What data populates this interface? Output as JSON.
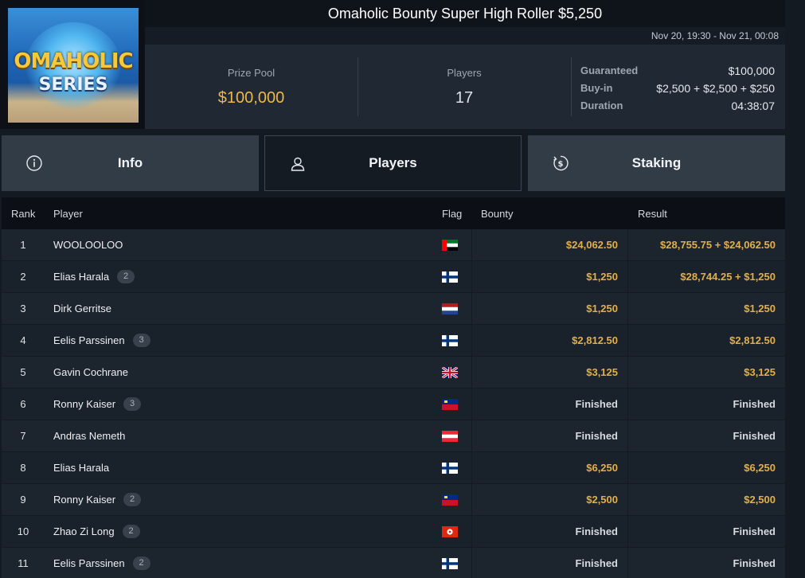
{
  "header": {
    "logo_text_top": "OMAHOLIC",
    "logo_text_bottom": "SERIES",
    "title": "Omaholic Bounty Super High Roller $5,250",
    "dates": "Nov 20, 19:30 - Nov 21, 00:08",
    "prize_pool_label": "Prize Pool",
    "prize_pool_value": "$100,000",
    "players_label": "Players",
    "players_value": "17",
    "details": [
      {
        "key": "Guaranteed",
        "value": "$100,000"
      },
      {
        "key": "Buy-in",
        "value": "$2,500 + $2,500 + $250"
      },
      {
        "key": "Duration",
        "value": "04:38:07"
      }
    ]
  },
  "tabs": [
    {
      "label": "Info",
      "icon": "info-icon",
      "active": false
    },
    {
      "label": "Players",
      "icon": "user-icon",
      "active": true
    },
    {
      "label": "Staking",
      "icon": "dollar-coin-icon",
      "active": false
    }
  ],
  "table": {
    "headers": {
      "rank": "Rank",
      "player": "Player",
      "flag": "Flag",
      "bounty": "Bounty",
      "result": "Result"
    },
    "rows": [
      {
        "rank": "1",
        "player": "WOOLOOLOO",
        "badge": "",
        "flag": "uae",
        "bounty": "$24,062.50",
        "result": "$28,755.75 + $24,062.50"
      },
      {
        "rank": "2",
        "player": "Elias Harala",
        "badge": "2",
        "flag": "finland",
        "bounty": "$1,250",
        "result": "$28,744.25 + $1,250"
      },
      {
        "rank": "3",
        "player": "Dirk Gerritse",
        "badge": "",
        "flag": "netherlands",
        "bounty": "$1,250",
        "result": "$1,250"
      },
      {
        "rank": "4",
        "player": "Eelis Parssinen",
        "badge": "3",
        "flag": "finland",
        "bounty": "$2,812.50",
        "result": "$2,812.50"
      },
      {
        "rank": "5",
        "player": "Gavin Cochrane",
        "badge": "",
        "flag": "uk",
        "bounty": "$3,125",
        "result": "$3,125"
      },
      {
        "rank": "6",
        "player": "Ronny Kaiser",
        "badge": "3",
        "flag": "liechtenstein",
        "bounty": "Finished",
        "result": "Finished"
      },
      {
        "rank": "7",
        "player": "Andras Nemeth",
        "badge": "",
        "flag": "austria",
        "bounty": "Finished",
        "result": "Finished"
      },
      {
        "rank": "8",
        "player": "Elias Harala",
        "badge": "",
        "flag": "finland",
        "bounty": "$6,250",
        "result": "$6,250"
      },
      {
        "rank": "9",
        "player": "Ronny Kaiser",
        "badge": "2",
        "flag": "liechtenstein",
        "bounty": "$2,500",
        "result": "$2,500"
      },
      {
        "rank": "10",
        "player": "Zhao Zi Long",
        "badge": "2",
        "flag": "hong-kong",
        "bounty": "Finished",
        "result": "Finished"
      },
      {
        "rank": "11",
        "player": "Eelis Parssinen",
        "badge": "2",
        "flag": "finland",
        "bounty": "Finished",
        "result": "Finished"
      }
    ]
  },
  "colors": {
    "accent_gold": "#e2b04a",
    "background": "#141a22",
    "panel": "#1f2833"
  }
}
